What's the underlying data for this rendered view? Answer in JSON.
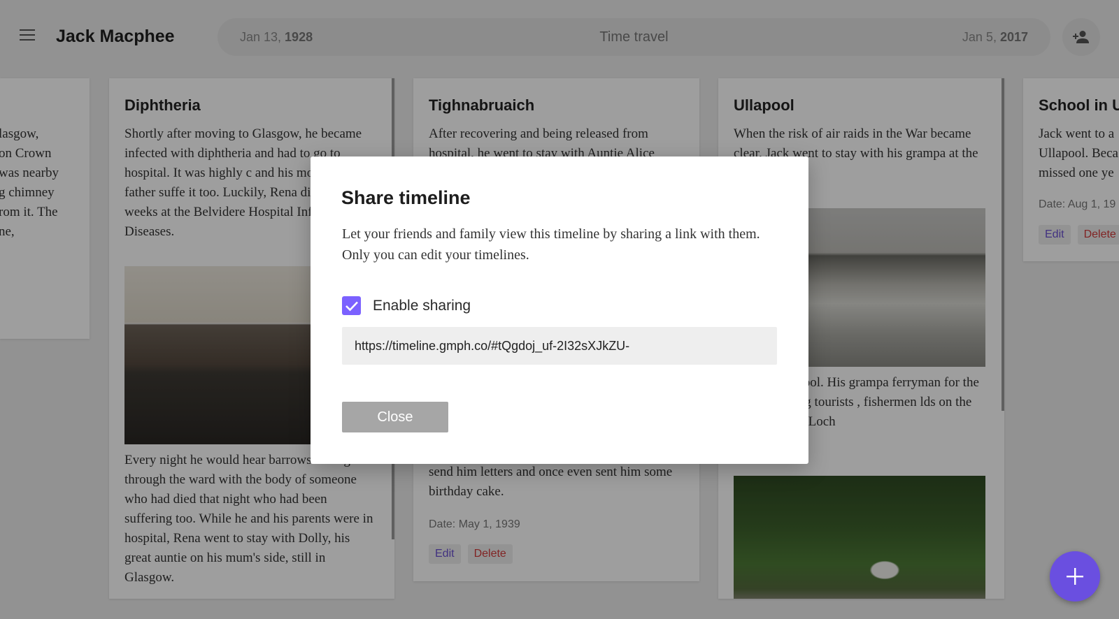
{
  "header": {
    "title": "Jack Macphee",
    "timebar": {
      "start_prefix": "Jan 13, ",
      "start_year": "1928",
      "center": "Time travel",
      "end_prefix": "Jan 5, ",
      "end_year": "2017"
    },
    "icons": {
      "menu": "menu-icon",
      "share": "person-add-icon"
    }
  },
  "cards": {
    "partial_left": {
      "lines": [
        "lasgow,",
        "on Crown",
        "was nearby",
        "g chimney",
        "rom it. The",
        "ne,"
      ]
    },
    "diphtheria": {
      "title": "Diphtheria",
      "text1": "Shortly after moving to Glasgow, he became infected with diphtheria and had to go to hospital. It was highly c and his mother and father suffe it too. Luckily, Rena did not. He weeks at the Belvidere Hospital Infectious Diseases.",
      "text2": "Every night he would hear barrows rolling through the ward with the body of someone who had died that night who had been suffering too. While he and his parents were in hospital, Rena went to stay with Dolly, his great auntie on his mum's side, still in Glasgow."
    },
    "tighnabruaich": {
      "title": "Tighnabruaich",
      "text1": "After recovering and being released from hospital, he went to stay with Auntie Alice",
      "text2": "send him letters and once even sent him some birthday cake.",
      "date": "Date: May 1, 1939",
      "edit": "Edit",
      "delete": "Delete"
    },
    "ullapool": {
      "title": "Ullapool",
      "text1": "When the risk of air raids in the War became clear, Jack went to stay with his grampa at the Point in",
      "text2": "Ullapool School. His grampa ferryman for the route to taking tourists , fishermen lds on the crossing over Loch"
    },
    "school": {
      "title": "School in U",
      "text": "Jack went to a Ullapool. Beca missed one ye",
      "date": "Date: Aug 1, 19",
      "edit": "Edit",
      "delete": "Delete"
    }
  },
  "modal": {
    "title": "Share timeline",
    "description": "Let your friends and family view this timeline by sharing a link with them. Only you can edit your timelines.",
    "checkbox_label": "Enable sharing",
    "checkbox_checked": true,
    "link": "https://timeline.gmph.co/#tQgdoj_uf-2I32sXJkZU-",
    "close_label": "Close"
  },
  "fab": {
    "icon": "plus-icon"
  },
  "colors": {
    "accent": "#6a4fe0",
    "checkbox": "#7b61ff",
    "delete": "#d03a3a",
    "edit": "#6a4fcf"
  }
}
